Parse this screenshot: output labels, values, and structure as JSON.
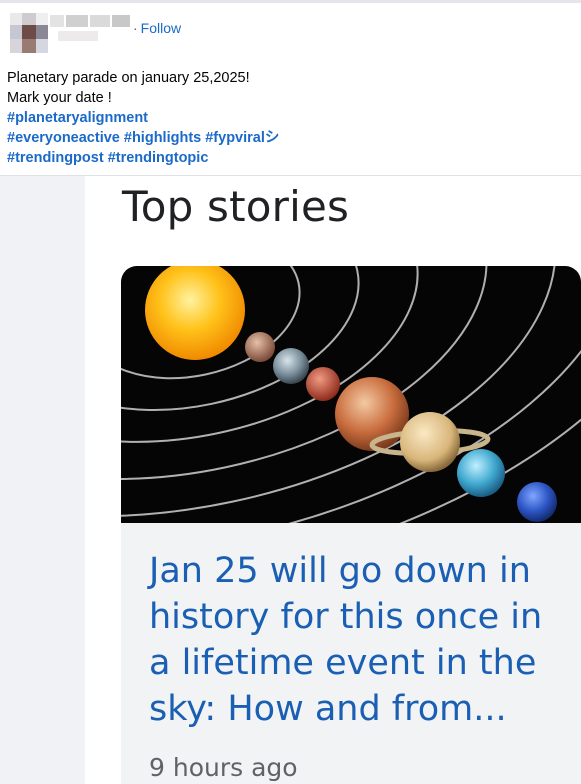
{
  "post": {
    "follow_separator": "·",
    "follow_label": "Follow",
    "text_lines": [
      "Planetary parade on january 25,2025!",
      "Mark your date !"
    ],
    "hashtag_lines": [
      "#planetaryalignment",
      "#everyoneactive #highlights #fypviralシ",
      "#trendingpost #trendingtopic"
    ]
  },
  "top_stories": {
    "heading": "Top stories",
    "story": {
      "headline_lines": [
        "Jan 25 will go down in",
        "history for this once in",
        "a lifetime event in the",
        "sky: How and from..."
      ],
      "time_ago": "9 hours ago",
      "image_icon": "solar-system-image"
    }
  },
  "colors": {
    "link": "#1b6ac9",
    "headline": "#1a5fb4",
    "muted": "#5f6368"
  }
}
